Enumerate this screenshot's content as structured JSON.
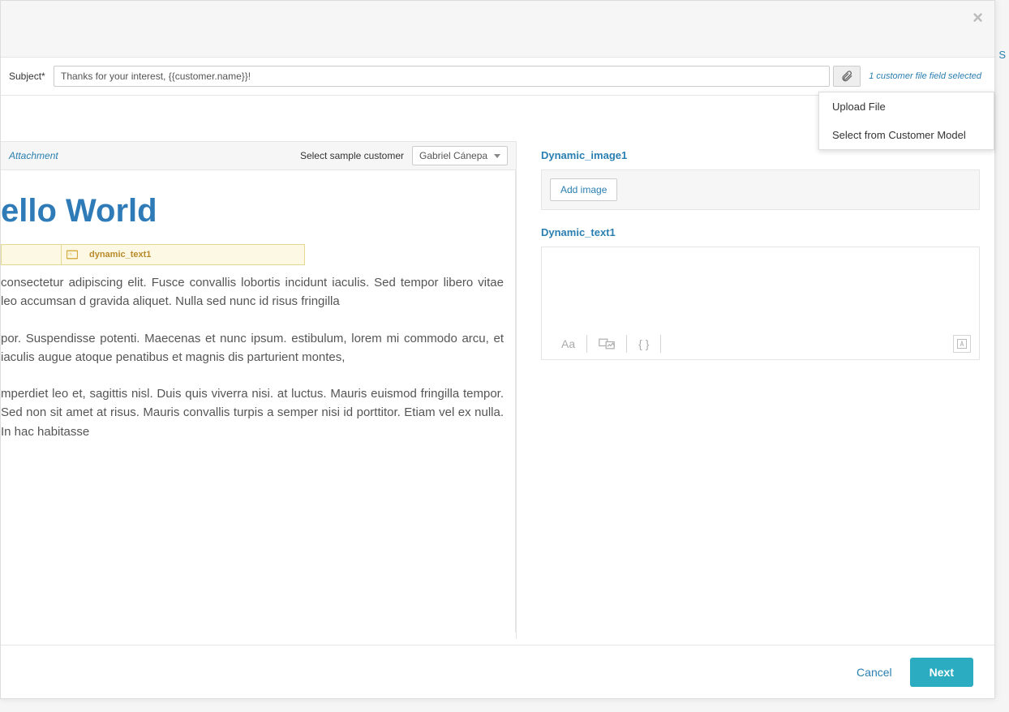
{
  "header": {
    "subject_label": "Subject*",
    "subject_value": "Thanks for your interest, {{customer.name}}!",
    "attach_hint": "1 customer file field selected",
    "dropdown": {
      "upload": "Upload File",
      "select_model": "Select from Customer Model"
    }
  },
  "preview": {
    "attachment_link": "Attachment",
    "sample_label": "Select sample customer",
    "sample_value": "Gabriel Cánepa",
    "title": "ello World",
    "dyn_text_label": "dynamic_text1",
    "para1": "consectetur adipiscing elit. Fusce convallis lobortis incidunt iaculis. Sed tempor libero vitae leo accumsan d gravida aliquet. Nulla sed nunc id risus fringilla",
    "para2": "por. Suspendisse potenti. Maecenas et nunc ipsum. estibulum, lorem mi commodo arcu, et iaculis augue atoque penatibus et magnis dis parturient montes,",
    "para3": "mperdiet leo et, sagittis nisl. Duis quis viverra nisi. at luctus. Mauris euismod fringilla tempor. Sed non sit amet at risus. Mauris convallis turpis a semper nisi id porttitor. Etiam vel ex nulla. In hac habitasse"
  },
  "right": {
    "dyn_image_label": "Dynamic_image1",
    "add_image": "Add image",
    "dyn_text_label": "Dynamic_text1",
    "tools": {
      "aa": "Aa",
      "braces": "{ }"
    }
  },
  "footer": {
    "cancel": "Cancel",
    "next": "Next"
  },
  "sidebar_hint": "S"
}
